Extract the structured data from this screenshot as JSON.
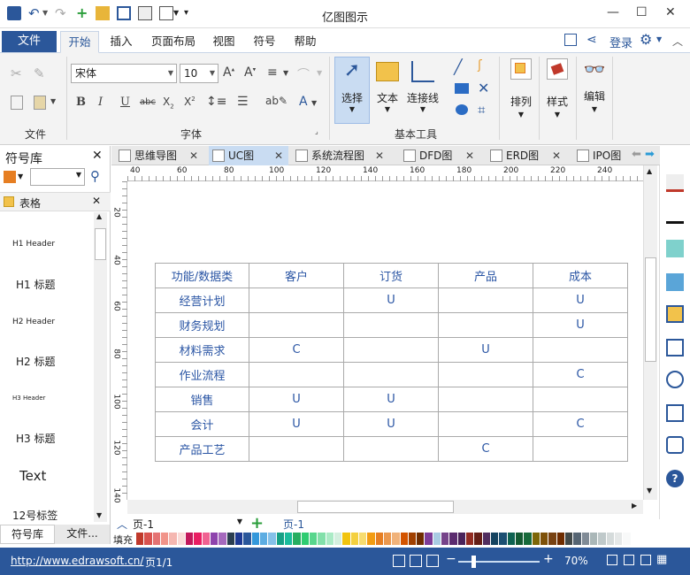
{
  "app": {
    "title": "亿图图示"
  },
  "menu": {
    "file": "文件",
    "tabs": [
      "开始",
      "插入",
      "页面布局",
      "视图",
      "符号",
      "帮助"
    ],
    "login": "登录"
  },
  "ribbon": {
    "groups": [
      "文件",
      "字体",
      "基本工具",
      "排列",
      "样式",
      "编辑"
    ],
    "font_name": "宋体",
    "font_size": "10",
    "tools": {
      "select": "选择",
      "text": "文本",
      "connector": "连接线"
    }
  },
  "left": {
    "title": "符号库",
    "lib_name": "表格",
    "items": [
      "H1 Header",
      "H1 标题",
      "H2 Header",
      "H2 标题",
      "H3 Header",
      "H3 标题",
      "Text",
      "12号标签"
    ],
    "bottom_tabs": [
      "符号库",
      "文件..."
    ]
  },
  "tabs": [
    "思维导图",
    "UC图",
    "系统流程图",
    "DFD图",
    "ERD图",
    "IPO图"
  ],
  "ruler": {
    "h": [
      "40",
      "60",
      "80",
      "100",
      "120",
      "140",
      "160",
      "180",
      "200",
      "220",
      "240"
    ],
    "v": [
      "20",
      "40",
      "60",
      "80",
      "100",
      "120",
      "140"
    ]
  },
  "table": {
    "header": [
      "功能/数据类",
      "客户",
      "订货",
      "产品",
      "成本"
    ],
    "rows": [
      [
        "经营计划",
        "",
        "U",
        "",
        "U"
      ],
      [
        "财务规划",
        "",
        "",
        "",
        "U"
      ],
      [
        "材料需求",
        "C",
        "",
        "U",
        ""
      ],
      [
        "作业流程",
        "",
        "",
        "",
        "C"
      ],
      [
        "销售",
        "U",
        "U",
        "",
        ""
      ],
      [
        "会计",
        "U",
        "U",
        "",
        "C"
      ],
      [
        "产品工艺",
        "",
        "",
        "C",
        ""
      ]
    ]
  },
  "pagebar": {
    "page": "页-1",
    "active": "页-1",
    "fill": "填充"
  },
  "status": {
    "url": "http://www.edrawsoft.cn/",
    "page": "页1/1",
    "zoom": "70%"
  },
  "colors": {
    "accent": "#2b579a",
    "table_text": "#2a55a4"
  }
}
